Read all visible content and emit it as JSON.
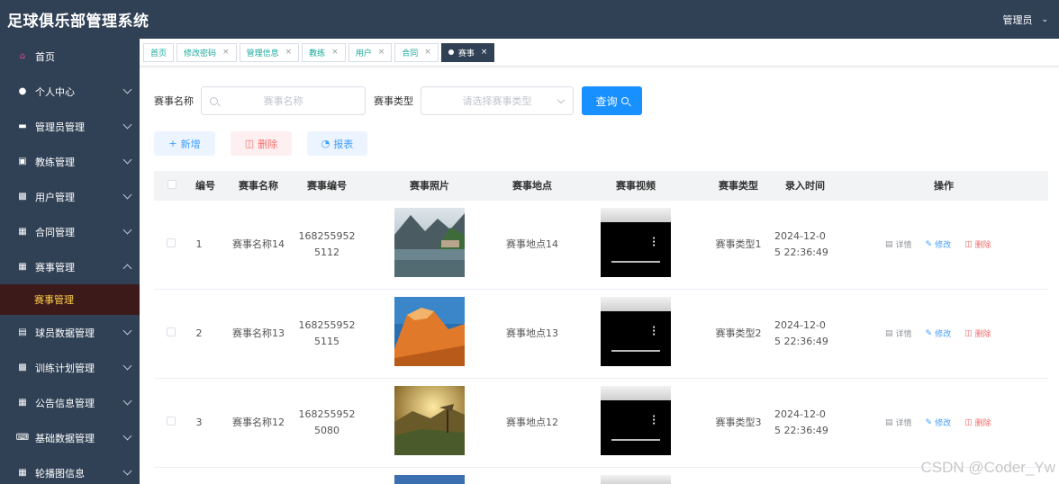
{
  "app": {
    "title": "足球俱乐部管理系统",
    "user": "管理员"
  },
  "sidebar": {
    "items": [
      {
        "label": "首页",
        "icon": "home-icon"
      },
      {
        "label": "个人中心",
        "icon": "user-icon"
      },
      {
        "label": "管理员管理",
        "icon": "admin-icon"
      },
      {
        "label": "教练管理",
        "icon": "coach-icon"
      },
      {
        "label": "用户管理",
        "icon": "monitor-icon"
      },
      {
        "label": "合同管理",
        "icon": "grid-icon"
      },
      {
        "label": "赛事管理",
        "icon": "grid-icon"
      },
      {
        "label": "球员数据管理",
        "icon": "doc-icon"
      },
      {
        "label": "训练计划管理",
        "icon": "monitor-icon"
      },
      {
        "label": "公告信息管理",
        "icon": "grid-icon"
      },
      {
        "label": "基础数据管理",
        "icon": "keyboard-icon"
      },
      {
        "label": "轮播图信息",
        "icon": "grid-icon"
      }
    ],
    "submenu_active": "赛事管理"
  },
  "tabs": [
    {
      "label": "首页",
      "closable": false
    },
    {
      "label": "修改密码",
      "closable": true
    },
    {
      "label": "管理信息",
      "closable": true
    },
    {
      "label": "教练",
      "closable": true
    },
    {
      "label": "用户",
      "closable": true
    },
    {
      "label": "合同",
      "closable": true
    },
    {
      "label": "赛事",
      "closable": true,
      "active": true
    }
  ],
  "search": {
    "name_label": "赛事名称",
    "name_placeholder": "赛事名称",
    "type_label": "赛事类型",
    "type_placeholder": "请选择赛事类型",
    "query_label": "查询"
  },
  "actions": {
    "add": "新增",
    "delete": "删除",
    "report": "报表"
  },
  "table": {
    "headers": [
      "编号",
      "赛事名称",
      "赛事编号",
      "赛事照片",
      "赛事地点",
      "赛事视频",
      "赛事类型",
      "录入时间",
      "操作"
    ],
    "rows": [
      {
        "no": "1",
        "name": "赛事名称14",
        "code_a": "168255952",
        "code_b": "5112",
        "place": "赛事地点14",
        "type": "赛事类型1",
        "time_a": "2024-12-0",
        "time_b": "5 22:36:49"
      },
      {
        "no": "2",
        "name": "赛事名称13",
        "code_a": "168255952",
        "code_b": "5115",
        "place": "赛事地点13",
        "type": "赛事类型2",
        "time_a": "2024-12-0",
        "time_b": "5 22:36:49"
      },
      {
        "no": "3",
        "name": "赛事名称12",
        "code_a": "168255952",
        "code_b": "5080",
        "place": "赛事地点12",
        "type": "赛事类型3",
        "time_a": "2024-12-0",
        "time_b": "5 22:36:49"
      }
    ],
    "op_labels": {
      "detail": "详情",
      "edit": "修改",
      "delete": "删除"
    }
  },
  "watermark": "CSDN @Coder_Yw",
  "colors": {
    "sidebar_bg": "#304156",
    "accent": "#1890ff",
    "active_sub_text": "#ffd04b",
    "tag_text": "#1aab9c"
  }
}
